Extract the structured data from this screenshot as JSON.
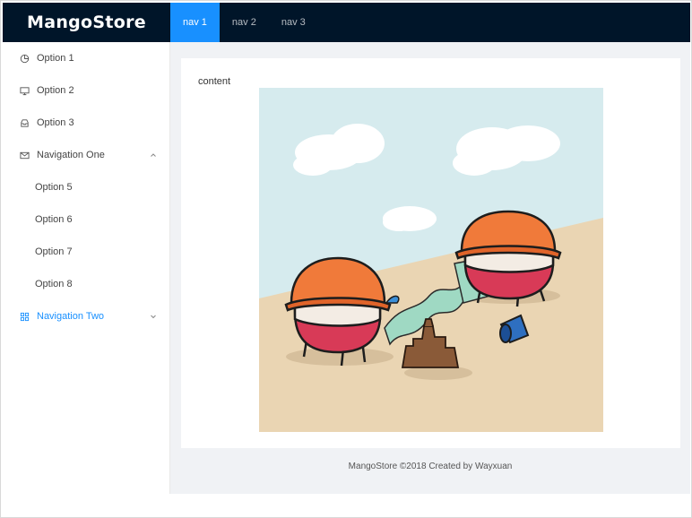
{
  "header": {
    "logo": "MangoStore",
    "nav": [
      {
        "label": "nav 1",
        "active": true
      },
      {
        "label": "nav 2",
        "active": false
      },
      {
        "label": "nav 3",
        "active": false
      }
    ]
  },
  "sider": {
    "items": [
      {
        "label": "Option 1",
        "icon": "pie-chart-icon"
      },
      {
        "label": "Option 2",
        "icon": "desktop-icon"
      },
      {
        "label": "Option 3",
        "icon": "inbox-icon"
      },
      {
        "label": "Navigation One",
        "icon": "mail-icon",
        "expanded": true
      },
      {
        "label": "Option 5"
      },
      {
        "label": "Option 6"
      },
      {
        "label": "Option 7"
      },
      {
        "label": "Option 8"
      },
      {
        "label": "Navigation Two",
        "icon": "appstore-icon",
        "expanded": false,
        "selected": true
      }
    ]
  },
  "main": {
    "content_label": "content"
  },
  "footer": {
    "text": "MangoStore ©2018 Created by Wayxuan"
  },
  "colors": {
    "header_bg": "#001529",
    "accent": "#1890ff",
    "layout_bg": "#f0f2f5"
  }
}
